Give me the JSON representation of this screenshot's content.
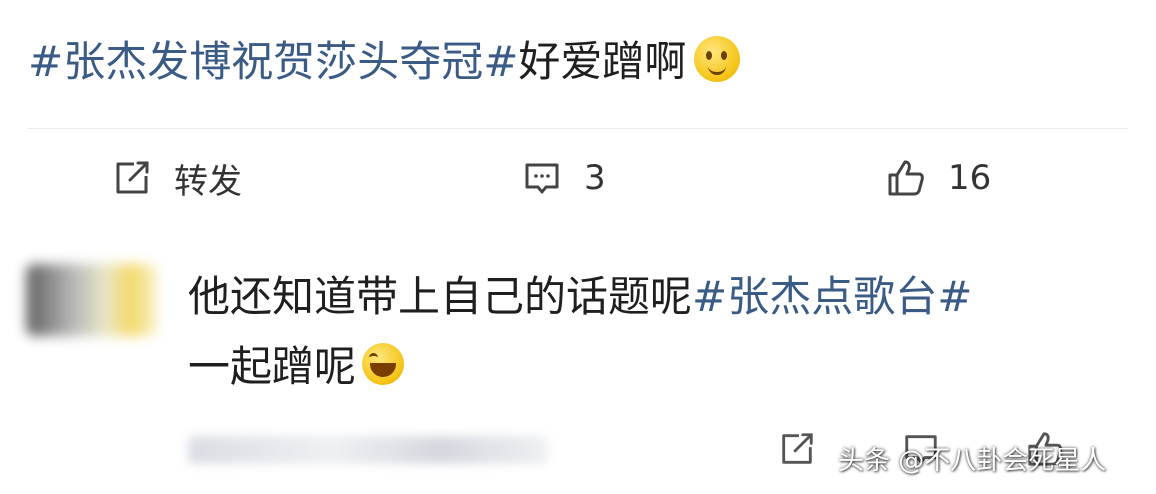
{
  "post": {
    "hashtag": "#张杰发博祝贺莎头夺冠#",
    "text": "好爱蹭啊",
    "emoji": "smirk-emoji"
  },
  "actions": {
    "repost_label": "转发",
    "comment_count": "3",
    "like_count": "16",
    "repost_icon": "share-icon",
    "comment_icon": "comment-icon",
    "like_icon": "thumbs-up-icon"
  },
  "comment": {
    "text_before": "他还知道带上自己的话题呢",
    "hashtag": "#张杰点歌台#",
    "text_after": "一起蹭呢",
    "emoji": "laughing-tears-emoji"
  },
  "watermark": {
    "text": "头条 @不八卦会死星人"
  },
  "colors": {
    "hashtag": "#3a5b86",
    "text": "#1f1f1f",
    "icon": "#444444"
  }
}
